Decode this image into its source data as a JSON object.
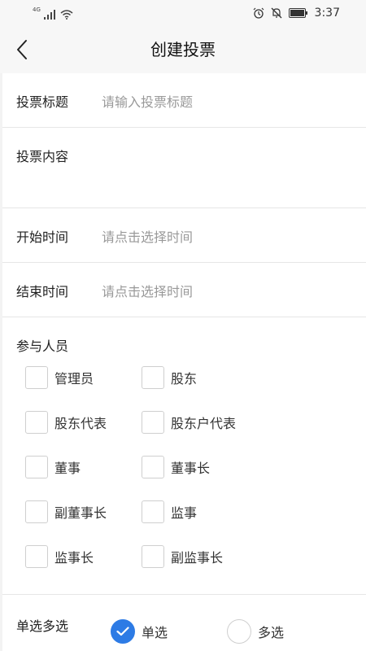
{
  "status_bar": {
    "network": "4G",
    "time": "3:37",
    "icons": [
      "signal-icon",
      "wifi-icon",
      "alarm-icon",
      "mute-icon",
      "battery-icon"
    ]
  },
  "header": {
    "title": "创建投票",
    "back_icon": "back-arrow-icon"
  },
  "form": {
    "title_label": "投票标题",
    "title_placeholder": "请输入投票标题",
    "content_label": "投票内容",
    "start_label": "开始时间",
    "start_placeholder": "请点击选择时间",
    "end_label": "结束时间",
    "end_placeholder": "请点击选择时间",
    "participants_label": "参与人员",
    "participants": [
      {
        "label": "管理员",
        "checked": false
      },
      {
        "label": "股东",
        "checked": false
      },
      {
        "label": "股东代表",
        "checked": false
      },
      {
        "label": "股东户代表",
        "checked": false
      },
      {
        "label": "董事",
        "checked": false
      },
      {
        "label": "董事长",
        "checked": false
      },
      {
        "label": "副董事长",
        "checked": false
      },
      {
        "label": "监事",
        "checked": false
      },
      {
        "label": "监事长",
        "checked": false
      },
      {
        "label": "副监事长",
        "checked": false
      }
    ],
    "mode_label": "单选多选",
    "mode_options": [
      {
        "label": "单选",
        "selected": true
      },
      {
        "label": "多选",
        "selected": false
      }
    ]
  },
  "colors": {
    "accent": "#2d7be5",
    "placeholder": "#999999",
    "divider": "#e6e6e6"
  }
}
